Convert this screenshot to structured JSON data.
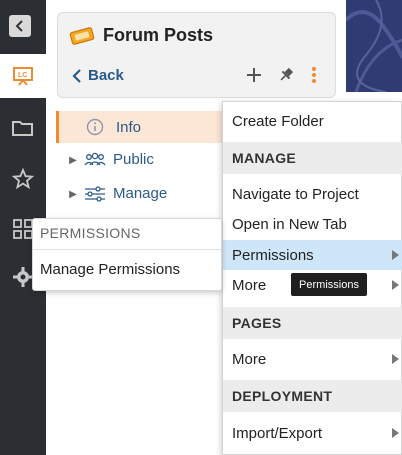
{
  "header": {
    "title": "Forum Posts",
    "back_label": "Back",
    "icon": "ticket-icon"
  },
  "rail": {
    "items": [
      {
        "name": "collapse",
        "icon": "chevron-left-icon"
      },
      {
        "name": "presentation",
        "icon": "presentation-icon",
        "active": true
      },
      {
        "name": "folder",
        "icon": "folder-icon"
      },
      {
        "name": "favorites",
        "icon": "star-icon"
      },
      {
        "name": "apps",
        "icon": "grid-icon"
      },
      {
        "name": "settings",
        "icon": "gear-icon"
      }
    ]
  },
  "tree": {
    "items": [
      {
        "label": "Info",
        "icon": "info-icon",
        "selected": true
      },
      {
        "label": "Public",
        "icon": "users-icon"
      },
      {
        "label": "Manage",
        "icon": "sliders-icon"
      }
    ]
  },
  "menu": {
    "create_folder": "Create Folder",
    "section_manage": "MANAGE",
    "navigate_to_project": "Navigate to Project",
    "open_in_new_tab": "Open in New Tab",
    "permissions": "Permissions",
    "more_manage": "More",
    "section_pages": "PAGES",
    "more_pages": "More",
    "section_deployment": "DEPLOYMENT",
    "import_export": "Import/Export"
  },
  "submenu": {
    "header": "PERMISSIONS",
    "manage_permissions": "Manage Permissions"
  },
  "tooltip": {
    "text": "Permissions"
  },
  "colors": {
    "rail_bg": "#2b2f33",
    "accent_orange": "#f08c2e",
    "link_blue": "#2a5a8c",
    "highlight_blue": "#cfe6f8"
  }
}
